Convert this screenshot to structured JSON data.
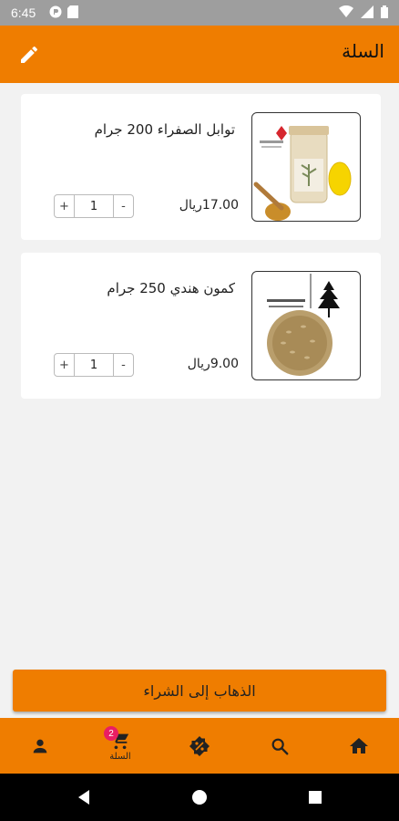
{
  "status_bar": {
    "time": "6:45"
  },
  "header": {
    "title": "السلة"
  },
  "cart": {
    "items": [
      {
        "name": "توابل الصفراء 200 جرام",
        "price": "17.00ريال",
        "quantity": "1",
        "plus": "+",
        "minus": "-"
      },
      {
        "name": "كمون هندي 250 جرام",
        "price": "9.00ريال",
        "quantity": "1",
        "plus": "+",
        "minus": "-"
      }
    ]
  },
  "checkout": {
    "label": "الذهاب إلى الشراء"
  },
  "bottom_nav": {
    "cart_label": "السلة",
    "cart_badge": "2",
    "active": "cart"
  },
  "colors": {
    "accent": "#ef7d00",
    "badge": "#e91e63"
  }
}
